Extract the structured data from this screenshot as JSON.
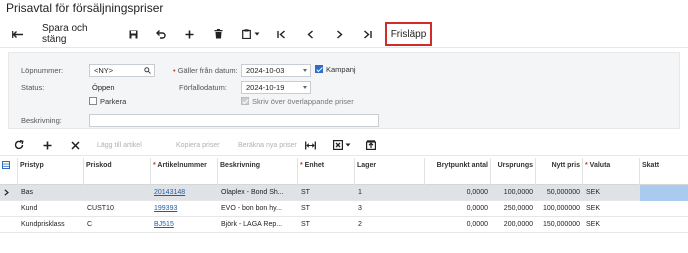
{
  "title": "Prisavtal för försäljningspriser",
  "toolbar": {
    "save_close": "Spara och stäng",
    "release": "Frisläpp"
  },
  "form": {
    "number_label": "Löpnummer:",
    "number_value": "<NY>",
    "status_label": "Status:",
    "status_value": "Öppen",
    "park_label": "Parkera",
    "valid_from_label": "Gäller från datum:",
    "valid_from_value": "2024-10-03",
    "campaign_label": "Kampanj",
    "expiry_label": "Förfallodatum:",
    "expiry_value": "2024-10-19",
    "overwrite_label": "Skriv över överlappande priser",
    "description_label": "Beskrivning:",
    "description_value": ""
  },
  "gridbar": {
    "add_item": "Lägg till artikel",
    "copy_prices": "Kopiera priser",
    "calc_prices": "Beräkna nya priser"
  },
  "grid": {
    "headers": {
      "pristyp": "Pristyp",
      "priskod": "Priskod",
      "artikel": "Artikelnummer",
      "beskrivning": "Beskrivning",
      "enhet": "Enhet",
      "lager": "Lager",
      "brytpunkt": "Brytpunkt antal",
      "ursprung": "Ursprungs",
      "nytt": "Nytt pris",
      "valuta": "Valuta",
      "skatt": "Skatt"
    },
    "rows": [
      {
        "pristyp": "Bas",
        "priskod": "",
        "artikel": "20143148",
        "beskrivning": "Olaplex - Bond Sh...",
        "enhet": "ST",
        "lager": "1",
        "brytpunkt": "0,0000",
        "ursprung": "100,0000",
        "nytt": "50,000000",
        "valuta": "SEK"
      },
      {
        "pristyp": "Kund",
        "priskod": "CUST10",
        "artikel": "199393",
        "beskrivning": "EVO - bon bon hy...",
        "enhet": "ST",
        "lager": "3",
        "brytpunkt": "0,0000",
        "ursprung": "250,0000",
        "nytt": "100,000000",
        "valuta": "SEK"
      },
      {
        "pristyp": "Kundprisklass",
        "priskod": "C",
        "artikel": "BJ515",
        "beskrivning": "Björk - LAGA Rep...",
        "enhet": "ST",
        "lager": "2",
        "brytpunkt": "0,0000",
        "ursprung": "200,0000",
        "nytt": "150,000000",
        "valuta": "SEK"
      }
    ]
  }
}
